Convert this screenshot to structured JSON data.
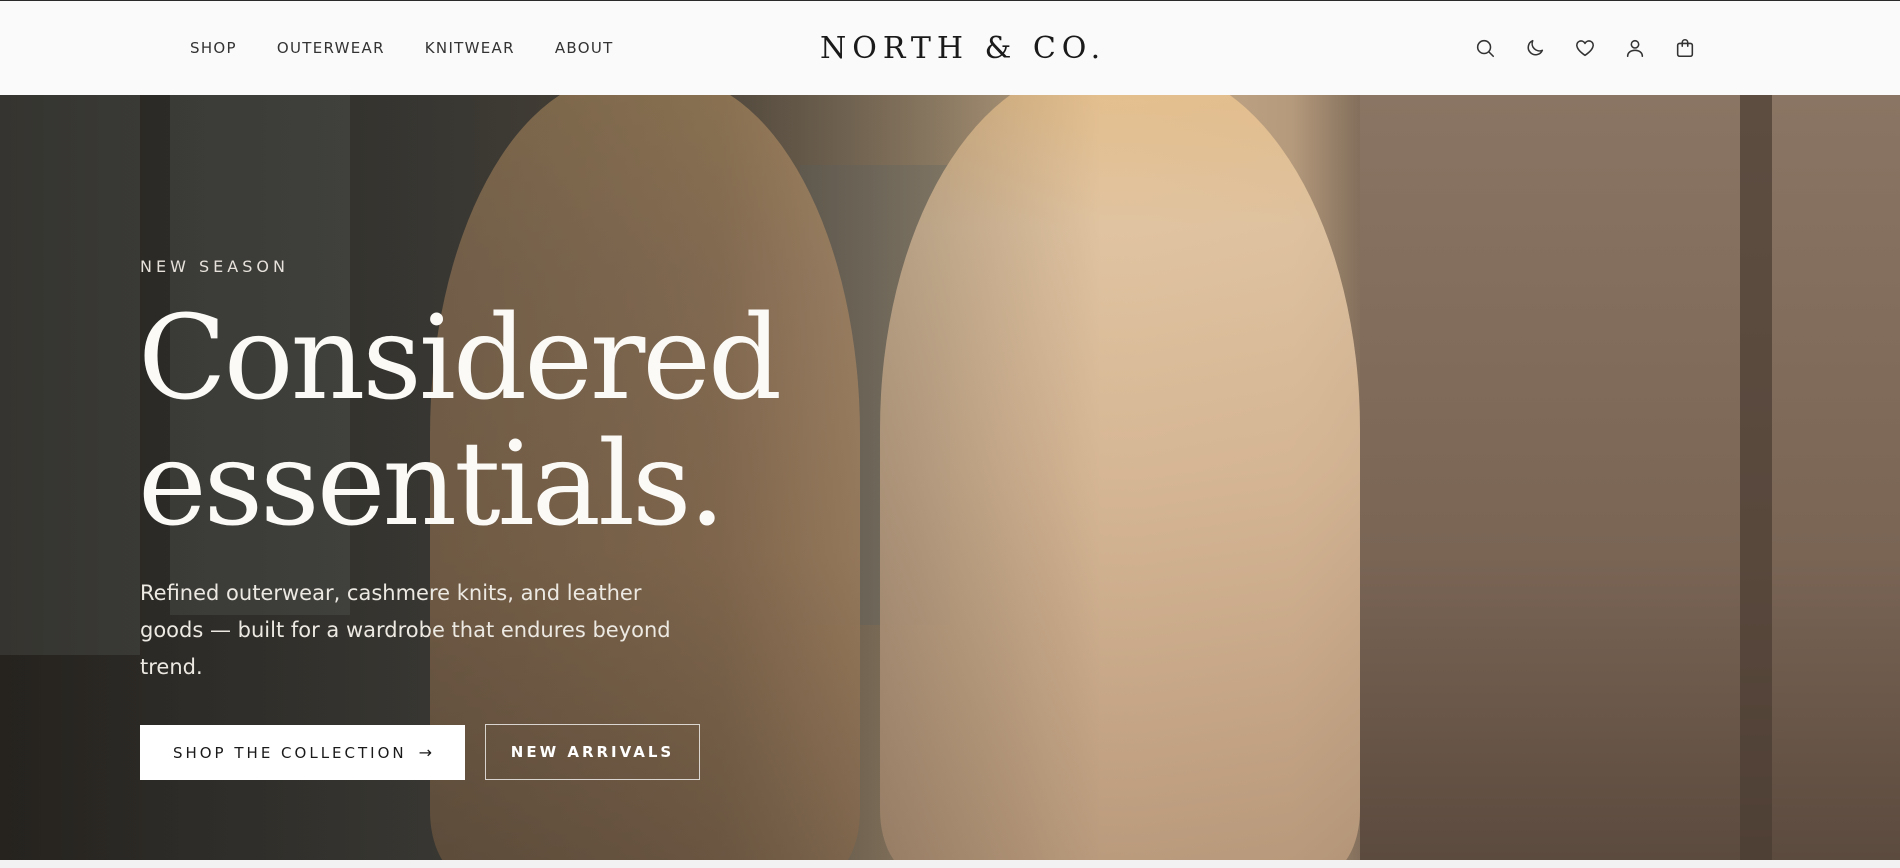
{
  "header": {
    "nav": [
      {
        "label": "SHOP"
      },
      {
        "label": "OUTERWEAR"
      },
      {
        "label": "KNITWEAR"
      },
      {
        "label": "ABOUT"
      }
    ],
    "logo": "NORTH & CO.",
    "icons": [
      "search-icon",
      "moon-icon",
      "heart-icon",
      "user-icon",
      "bag-icon"
    ]
  },
  "hero": {
    "eyebrow": "NEW SEASON",
    "headline_line1": "Considered",
    "headline_line2": "essentials.",
    "lead": "Refined outerwear, cashmere knits, and leather goods — built for a wardrobe that endures beyond trend.",
    "primary_cta": "SHOP THE COLLECTION",
    "secondary_cta": "NEW ARRIVALS"
  },
  "colors": {
    "header_bg": "#fafafa",
    "text_dark": "#1a1a1a",
    "hero_text": "#fbfaf7",
    "button_bg": "#ffffff"
  }
}
